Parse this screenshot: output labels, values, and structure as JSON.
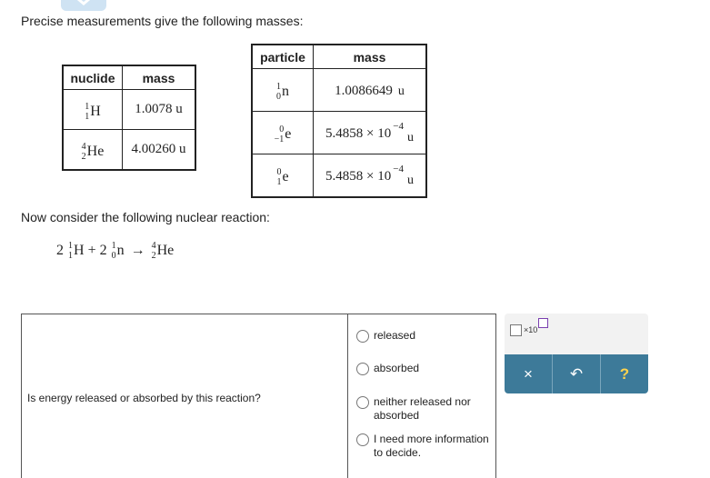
{
  "intro": "Precise measurements give the following masses:",
  "nuclide_table": {
    "headers": [
      "nuclide",
      "mass"
    ],
    "rows": [
      {
        "mass_number": "1",
        "atomic_number": "1",
        "symbol": "H",
        "mass": "1.0078 u"
      },
      {
        "mass_number": "4",
        "atomic_number": "2",
        "symbol": "He",
        "mass": "4.00260 u"
      }
    ]
  },
  "particle_table": {
    "headers": [
      "particle",
      "mass"
    ],
    "rows": [
      {
        "top": "1",
        "bottom": "0",
        "symbol": "n",
        "mantissa": "1.0086649",
        "times": "",
        "exponent": "",
        "unit": "u"
      },
      {
        "top": "0",
        "bottom": "−1",
        "symbol": "e",
        "mantissa": "5.4858",
        "times": " × 10",
        "exponent": "−4",
        "unit": "u"
      },
      {
        "top": "0",
        "bottom": "1",
        "symbol": "e",
        "mantissa": "5.4858",
        "times": " × 10",
        "exponent": "−4",
        "unit": "u"
      }
    ]
  },
  "consider": "Now consider the following nuclear reaction:",
  "reaction": {
    "term1": {
      "coef": "2",
      "top": "1",
      "bottom": "1",
      "symbol": "H"
    },
    "plus": "+",
    "term2": {
      "coef": "2",
      "top": "1",
      "bottom": "0",
      "symbol": "n"
    },
    "arrow": "→",
    "product": {
      "top": "4",
      "bottom": "2",
      "symbol": "He"
    }
  },
  "question": "Is energy released or absorbed by this reaction?",
  "options": [
    "released",
    "absorbed",
    "neither released nor absorbed",
    "I need more information to decide."
  ],
  "toolbox": {
    "x10_label": "×10",
    "clear": "×",
    "undo": "↶",
    "help": "?"
  }
}
